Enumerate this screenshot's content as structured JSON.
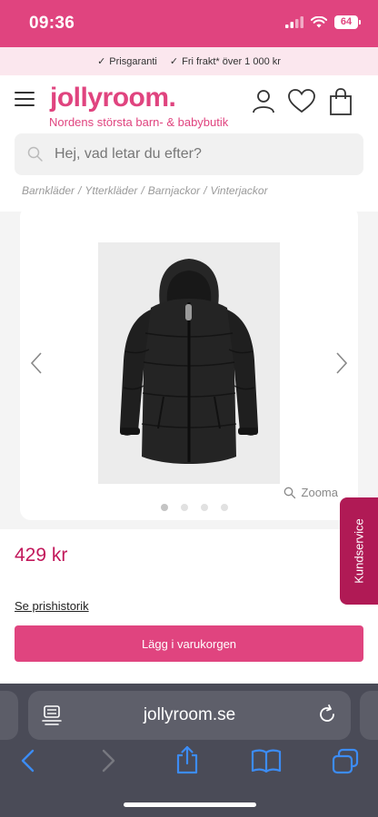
{
  "status_bar": {
    "time": "09:36",
    "battery": "64"
  },
  "usp": [
    {
      "label": "Prisgaranti"
    },
    {
      "label": "Fri frakt* över 1 000 kr"
    }
  ],
  "header": {
    "logo": "jollyroom.",
    "tagline": "Nordens största barn- & babybutik",
    "search_placeholder": "Hej, vad letar du efter?"
  },
  "breadcrumb": [
    {
      "label": "Barnkläder"
    },
    {
      "label": "Ytterkläder"
    },
    {
      "label": "Barnjackor"
    },
    {
      "label": "Vinterjackor"
    }
  ],
  "product": {
    "zoom_label": "Zooma",
    "image_count": 4,
    "active_image": 0,
    "price": "429 kr",
    "price_history": "Se prishistorik",
    "add_to_cart": "Lägg i varukorgen"
  },
  "kundservice": "Kundservice",
  "browser": {
    "url": "jollyroom.se"
  },
  "colors": {
    "brand": "#e0447f",
    "price": "#c2185b",
    "kundservice": "#b01a55",
    "browser_chrome": "#4a4b57"
  }
}
